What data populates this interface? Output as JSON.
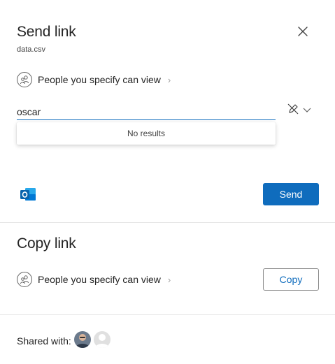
{
  "send_link": {
    "title": "Send link",
    "file_name": "data.csv",
    "permission_label": "People you specify can view",
    "recipient_value": "oscar",
    "dropdown_message": "No results",
    "send_label": "Send"
  },
  "copy_link": {
    "title": "Copy link",
    "permission_label": "People you specify can view",
    "copy_label": "Copy"
  },
  "shared_with": {
    "label": "Shared with:"
  },
  "colors": {
    "accent": "#0f6cbd",
    "outlook_blue": "#0a64ad"
  }
}
